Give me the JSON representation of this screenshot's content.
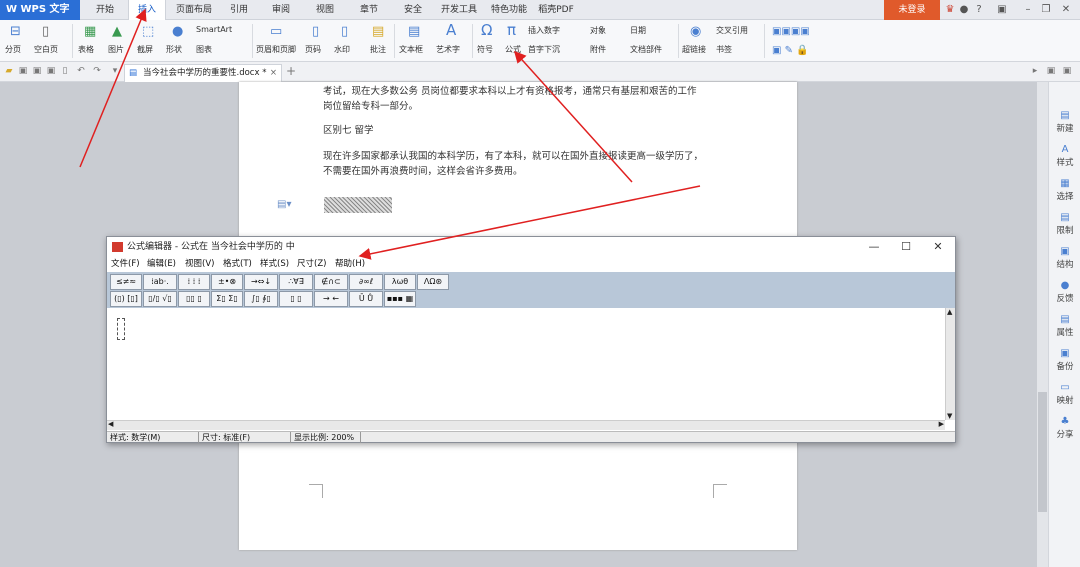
{
  "app": {
    "name": "W WPS 文字"
  },
  "menu": {
    "tabs": [
      "开始",
      "插入",
      "页面布局",
      "引用",
      "审阅",
      "视图",
      "章节",
      "安全",
      "开发工具",
      "特色功能",
      "稻壳PDF"
    ],
    "active": "插入",
    "login": "未登录"
  },
  "ribbon": {
    "page_blank": "分页",
    "blank_page": "空白页",
    "table": "表格",
    "picture": "图片",
    "screenshot": "截屏",
    "shape": "形状",
    "chart": "图表",
    "smartart": "SmartArt",
    "header_footer": "页眉和页脚",
    "page_number": "页码",
    "watermark": "水印",
    "comment": "批注",
    "textbox": "文本框",
    "wordart": "艺术字",
    "symbol": "符号",
    "formula": "公式",
    "insert_number": "插入数字",
    "object": "对象",
    "date": "日期",
    "dropcap": "首字下沉",
    "attachment": "附件",
    "doc_parts": "文档部件",
    "cross_ref": "交叉引用",
    "hyperlink": "超链接",
    "bookmark": "书签"
  },
  "doc_tab": {
    "title": "当今社会中学历的重要性.docx *"
  },
  "document": {
    "p1_line1": "考试，现在大多数公务 员岗位都要求本科以上才有资格报考，通常只有基层和艰苦的工作",
    "p1_line2": "岗位留给专科一部分。",
    "heading7": "区别七  留学",
    "p2_line1": "现在许多国家都承认我国的本科学历，有了本科，就可以在国外直接报读更高一级学历了，",
    "p2_line2": "不需要在国外再浪费时间，这样会省许多费用。"
  },
  "sidebar": {
    "items": [
      "新建",
      "样式",
      "选择",
      "限制",
      "结构",
      "反馈",
      "属性",
      "备份",
      "映射",
      "分享"
    ]
  },
  "equation_editor": {
    "title": "公式编辑器 - 公式在 当今社会中学历的 中",
    "menus": [
      "文件(F)",
      "编辑(E)",
      "视图(V)",
      "格式(T)",
      "样式(S)",
      "尺寸(Z)",
      "帮助(H)"
    ],
    "toolbar_row1": [
      "≤≠≈",
      "⁞ab·.",
      "⁞ ⁞ ⁞",
      "±•⊗",
      "→⇔↓",
      "∴∀∃",
      "∉∩⊂",
      "∂∞ℓ",
      "λωθ",
      "ΛΩ⊛"
    ],
    "toolbar_row2": [
      "(▯) [▯]",
      "▯/▯ √▯",
      "▯▯ ▯",
      "Σ▯ Σ▯",
      "∫▯ ∮▯",
      "▯ ▯",
      "→ ←",
      "Ū Ů",
      "▪▪▪ ▦"
    ],
    "status": {
      "style": "样式: 数学(M)",
      "size": "尺寸: 标准(F)",
      "zoom": "显示比例: 200%"
    },
    "controls": {
      "minimize": "—",
      "maximize": "☐",
      "close": "✕"
    }
  },
  "colors": {
    "accent": "#2b6fd6",
    "login": "#e05a2b",
    "arrow": "#e02020",
    "eq_toolbar": "#b8c7d8"
  }
}
